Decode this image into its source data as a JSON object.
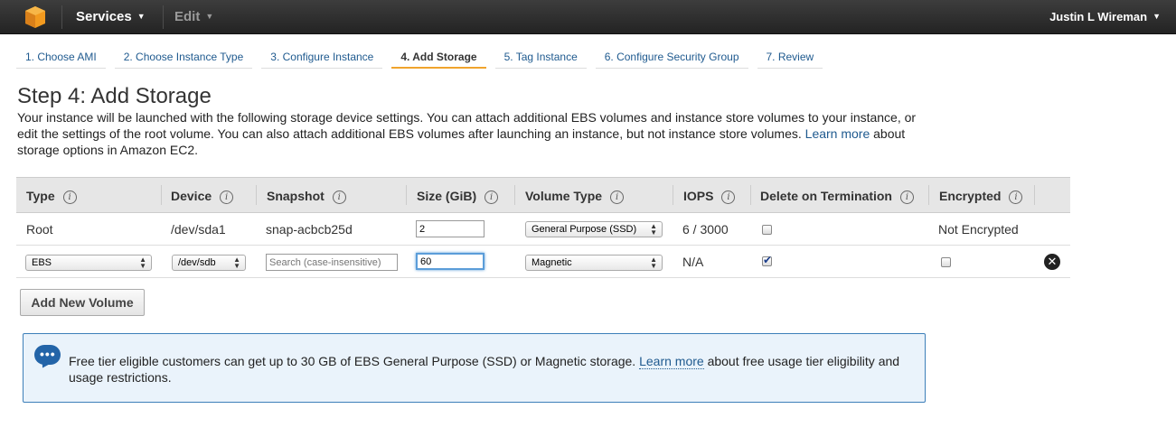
{
  "header": {
    "services_label": "Services",
    "edit_label": "Edit",
    "user_name": "Justin L Wireman"
  },
  "tabs": [
    {
      "label": "1. Choose AMI"
    },
    {
      "label": "2. Choose Instance Type"
    },
    {
      "label": "3. Configure Instance"
    },
    {
      "label": "4. Add Storage",
      "active": true
    },
    {
      "label": "5. Tag Instance"
    },
    {
      "label": "6. Configure Security Group"
    },
    {
      "label": "7. Review"
    }
  ],
  "page": {
    "title": "Step 4: Add Storage",
    "desc_1": "Your instance will be launched with the following storage device settings. You can attach additional EBS volumes and instance store volumes to your instance, or edit the settings of the root volume. You can also attach additional EBS volumes after launching an instance, but not instance store volumes.",
    "desc_link": "Learn more",
    "desc_2": "about storage options in Amazon EC2."
  },
  "table": {
    "headers": {
      "type": "Type",
      "device": "Device",
      "snapshot": "Snapshot",
      "size": "Size (GiB)",
      "volume_type": "Volume Type",
      "iops": "IOPS",
      "delete": "Delete on Termination",
      "encrypted": "Encrypted"
    },
    "row1": {
      "type": "Root",
      "device": "/dev/sda1",
      "snapshot": "snap-acbcb25d",
      "size": "2",
      "volume_type": "General Purpose (SSD)",
      "iops": "6 / 3000",
      "delete_checked": false,
      "encrypted": "Not Encrypted"
    },
    "row2": {
      "type": "EBS",
      "device": "/dev/sdb",
      "snapshot_placeholder": "Search (case-insensitive)",
      "size": "60",
      "volume_type": "Magnetic",
      "iops": "N/A",
      "delete_checked": true,
      "encrypted_checked": false
    }
  },
  "add_volume_label": "Add New Volume",
  "info": {
    "text_1": "Free tier eligible customers can get up to 30 GB of EBS General Purpose (SSD) or Magnetic storage.",
    "link": "Learn more",
    "text_2": "about free usage tier eligibility and usage restrictions."
  },
  "colors": {
    "accent_tab": "#f0a42d",
    "link": "#1f5a8f",
    "info_bg": "#eaf3fb"
  }
}
